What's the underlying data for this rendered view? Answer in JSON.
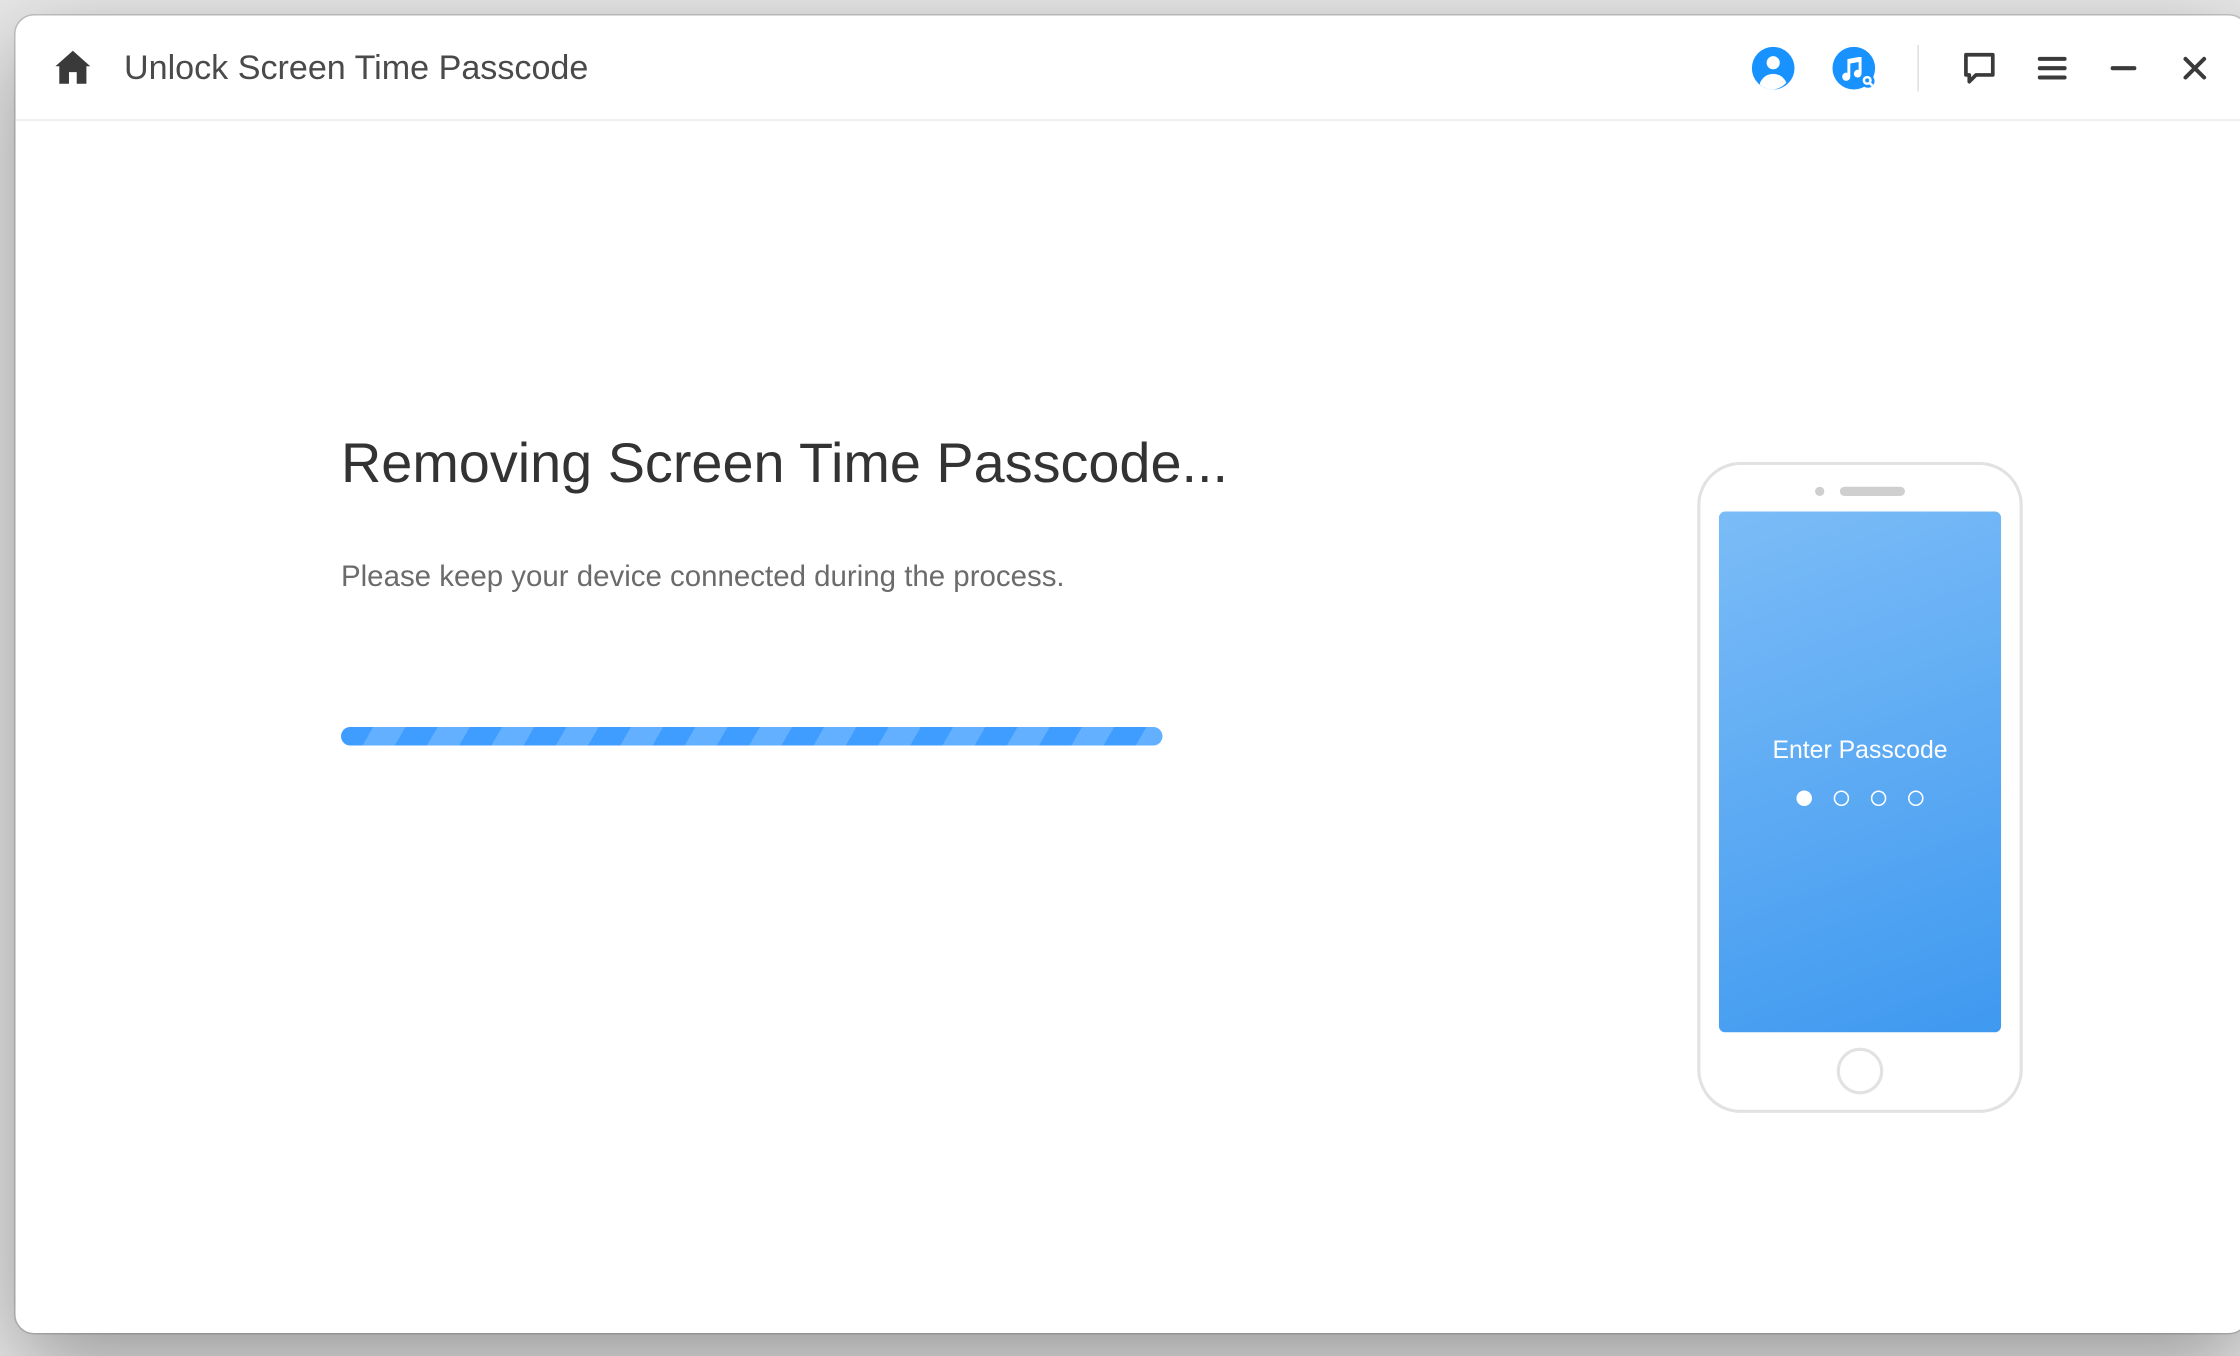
{
  "titlebar": {
    "title": "Unlock Screen Time Passcode"
  },
  "main": {
    "heading": "Removing Screen Time Passcode...",
    "subtext": "Please keep your device connected during the process."
  },
  "phone": {
    "screen_label": "Enter Passcode"
  }
}
